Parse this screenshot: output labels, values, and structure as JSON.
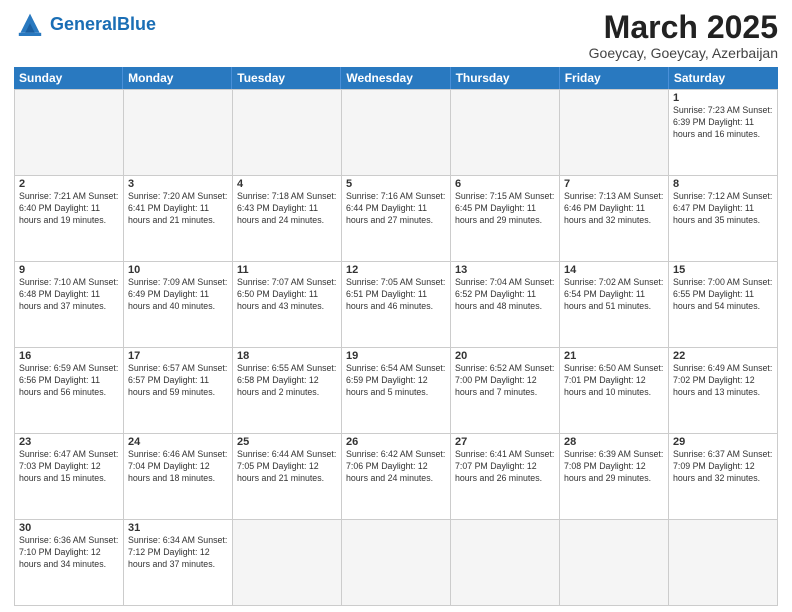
{
  "header": {
    "logo_general": "General",
    "logo_blue": "Blue",
    "month_title": "March 2025",
    "subtitle": "Goeycay, Goeycay, Azerbaijan"
  },
  "days_of_week": [
    "Sunday",
    "Monday",
    "Tuesday",
    "Wednesday",
    "Thursday",
    "Friday",
    "Saturday"
  ],
  "weeks": [
    [
      {
        "day": "",
        "info": "",
        "empty": true
      },
      {
        "day": "",
        "info": "",
        "empty": true
      },
      {
        "day": "",
        "info": "",
        "empty": true
      },
      {
        "day": "",
        "info": "",
        "empty": true
      },
      {
        "day": "",
        "info": "",
        "empty": true
      },
      {
        "day": "",
        "info": "",
        "empty": true
      },
      {
        "day": "1",
        "info": "Sunrise: 7:23 AM\nSunset: 6:39 PM\nDaylight: 11 hours and 16 minutes.",
        "empty": false
      }
    ],
    [
      {
        "day": "2",
        "info": "Sunrise: 7:21 AM\nSunset: 6:40 PM\nDaylight: 11 hours and 19 minutes.",
        "empty": false
      },
      {
        "day": "3",
        "info": "Sunrise: 7:20 AM\nSunset: 6:41 PM\nDaylight: 11 hours and 21 minutes.",
        "empty": false
      },
      {
        "day": "4",
        "info": "Sunrise: 7:18 AM\nSunset: 6:43 PM\nDaylight: 11 hours and 24 minutes.",
        "empty": false
      },
      {
        "day": "5",
        "info": "Sunrise: 7:16 AM\nSunset: 6:44 PM\nDaylight: 11 hours and 27 minutes.",
        "empty": false
      },
      {
        "day": "6",
        "info": "Sunrise: 7:15 AM\nSunset: 6:45 PM\nDaylight: 11 hours and 29 minutes.",
        "empty": false
      },
      {
        "day": "7",
        "info": "Sunrise: 7:13 AM\nSunset: 6:46 PM\nDaylight: 11 hours and 32 minutes.",
        "empty": false
      },
      {
        "day": "8",
        "info": "Sunrise: 7:12 AM\nSunset: 6:47 PM\nDaylight: 11 hours and 35 minutes.",
        "empty": false
      }
    ],
    [
      {
        "day": "9",
        "info": "Sunrise: 7:10 AM\nSunset: 6:48 PM\nDaylight: 11 hours and 37 minutes.",
        "empty": false
      },
      {
        "day": "10",
        "info": "Sunrise: 7:09 AM\nSunset: 6:49 PM\nDaylight: 11 hours and 40 minutes.",
        "empty": false
      },
      {
        "day": "11",
        "info": "Sunrise: 7:07 AM\nSunset: 6:50 PM\nDaylight: 11 hours and 43 minutes.",
        "empty": false
      },
      {
        "day": "12",
        "info": "Sunrise: 7:05 AM\nSunset: 6:51 PM\nDaylight: 11 hours and 46 minutes.",
        "empty": false
      },
      {
        "day": "13",
        "info": "Sunrise: 7:04 AM\nSunset: 6:52 PM\nDaylight: 11 hours and 48 minutes.",
        "empty": false
      },
      {
        "day": "14",
        "info": "Sunrise: 7:02 AM\nSunset: 6:54 PM\nDaylight: 11 hours and 51 minutes.",
        "empty": false
      },
      {
        "day": "15",
        "info": "Sunrise: 7:00 AM\nSunset: 6:55 PM\nDaylight: 11 hours and 54 minutes.",
        "empty": false
      }
    ],
    [
      {
        "day": "16",
        "info": "Sunrise: 6:59 AM\nSunset: 6:56 PM\nDaylight: 11 hours and 56 minutes.",
        "empty": false
      },
      {
        "day": "17",
        "info": "Sunrise: 6:57 AM\nSunset: 6:57 PM\nDaylight: 11 hours and 59 minutes.",
        "empty": false
      },
      {
        "day": "18",
        "info": "Sunrise: 6:55 AM\nSunset: 6:58 PM\nDaylight: 12 hours and 2 minutes.",
        "empty": false
      },
      {
        "day": "19",
        "info": "Sunrise: 6:54 AM\nSunset: 6:59 PM\nDaylight: 12 hours and 5 minutes.",
        "empty": false
      },
      {
        "day": "20",
        "info": "Sunrise: 6:52 AM\nSunset: 7:00 PM\nDaylight: 12 hours and 7 minutes.",
        "empty": false
      },
      {
        "day": "21",
        "info": "Sunrise: 6:50 AM\nSunset: 7:01 PM\nDaylight: 12 hours and 10 minutes.",
        "empty": false
      },
      {
        "day": "22",
        "info": "Sunrise: 6:49 AM\nSunset: 7:02 PM\nDaylight: 12 hours and 13 minutes.",
        "empty": false
      }
    ],
    [
      {
        "day": "23",
        "info": "Sunrise: 6:47 AM\nSunset: 7:03 PM\nDaylight: 12 hours and 15 minutes.",
        "empty": false
      },
      {
        "day": "24",
        "info": "Sunrise: 6:46 AM\nSunset: 7:04 PM\nDaylight: 12 hours and 18 minutes.",
        "empty": false
      },
      {
        "day": "25",
        "info": "Sunrise: 6:44 AM\nSunset: 7:05 PM\nDaylight: 12 hours and 21 minutes.",
        "empty": false
      },
      {
        "day": "26",
        "info": "Sunrise: 6:42 AM\nSunset: 7:06 PM\nDaylight: 12 hours and 24 minutes.",
        "empty": false
      },
      {
        "day": "27",
        "info": "Sunrise: 6:41 AM\nSunset: 7:07 PM\nDaylight: 12 hours and 26 minutes.",
        "empty": false
      },
      {
        "day": "28",
        "info": "Sunrise: 6:39 AM\nSunset: 7:08 PM\nDaylight: 12 hours and 29 minutes.",
        "empty": false
      },
      {
        "day": "29",
        "info": "Sunrise: 6:37 AM\nSunset: 7:09 PM\nDaylight: 12 hours and 32 minutes.",
        "empty": false
      }
    ],
    [
      {
        "day": "30",
        "info": "Sunrise: 6:36 AM\nSunset: 7:10 PM\nDaylight: 12 hours and 34 minutes.",
        "empty": false
      },
      {
        "day": "31",
        "info": "Sunrise: 6:34 AM\nSunset: 7:12 PM\nDaylight: 12 hours and 37 minutes.",
        "empty": false
      },
      {
        "day": "",
        "info": "",
        "empty": true
      },
      {
        "day": "",
        "info": "",
        "empty": true
      },
      {
        "day": "",
        "info": "",
        "empty": true
      },
      {
        "day": "",
        "info": "",
        "empty": true
      },
      {
        "day": "",
        "info": "",
        "empty": true
      }
    ]
  ]
}
